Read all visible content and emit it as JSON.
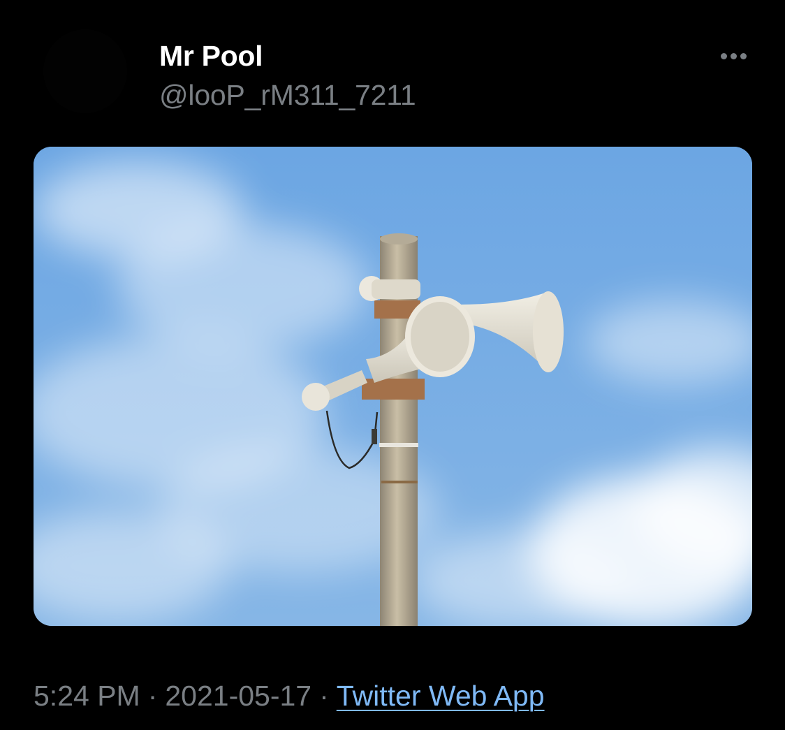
{
  "author": {
    "display_name": "Mr Pool",
    "handle": "@looP_rM311_7211",
    "avatar_icon": "avatar"
  },
  "more_button": {
    "icon": "more-horizontal-icon"
  },
  "media": {
    "icon": "photo",
    "subject": "siren-horns-on-pole",
    "sky_color": "#6fa6df"
  },
  "meta": {
    "time": "5:24 PM",
    "separator": "·",
    "date": "2021-05-17",
    "source": "Twitter Web App",
    "source_color": "#7fb9f6"
  },
  "colors": {
    "background": "#000000",
    "primary_text": "#ffffff",
    "secondary_text": "#7a7f84"
  }
}
